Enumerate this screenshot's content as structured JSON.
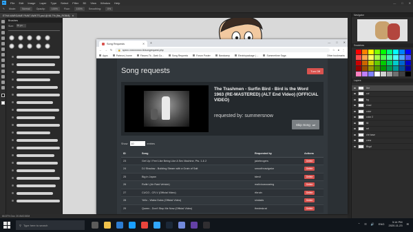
{
  "photoshop": {
    "logo": "Ps",
    "menus": [
      "File",
      "Edit",
      "Image",
      "Layer",
      "Type",
      "Select",
      "Filter",
      "3D",
      "View",
      "Window",
      "Help"
    ],
    "options": {
      "mode_label": "Mode:",
      "mode_value": "Normal",
      "opacity_label": "Opacity:",
      "opacity_value": "100%",
      "flow_label": "Flow:",
      "flow_value": "100%",
      "smoothing_label": "Smoothing:",
      "smoothing_value": "0%"
    },
    "doc_tab": "ETHA WARGAME PAINT AWKTS.psd @ 66.7% (fbs_RGB/8)",
    "brush_panel_title": "Brushes",
    "brush_size_label": "Size:",
    "brush_size_value": "36 px",
    "status": "66.67%   Doc: 20.6M/2.80M",
    "navigator_title": "Navigator",
    "swatches_title": "Swatches",
    "layers_title": "Layers",
    "layers": [
      "line",
      "col",
      "bg",
      "shad",
      "color",
      "color 2",
      "fill",
      "ref",
      "chr base",
      "crew",
      "Bkgd"
    ],
    "swatch_colors": [
      "#ff0000",
      "#ff8000",
      "#ffff00",
      "#80ff00",
      "#00ff00",
      "#00ff80",
      "#00ffff",
      "#0080ff",
      "#0000ff",
      "#ff4d4d",
      "#ffa64d",
      "#ffff66",
      "#a6ff4d",
      "#4dff4d",
      "#4dffa6",
      "#4dffff",
      "#4da6ff",
      "#4d4dff",
      "#cc0000",
      "#cc6600",
      "#cccc00",
      "#66cc00",
      "#00cc00",
      "#00cc66",
      "#00cccc",
      "#0066cc",
      "#0000cc",
      "#990000",
      "#994d00",
      "#999900",
      "#4d9900",
      "#009900",
      "#00994d",
      "#009999",
      "#004d99",
      "#000099",
      "#ff80c0",
      "#c080ff",
      "#8080ff",
      "#ffffff",
      "#d0d0d0",
      "#a0a0a0",
      "#707070",
      "#404040",
      "#000000"
    ]
  },
  "browser": {
    "tab_title": "Song Requests",
    "url": "spxxx.xxxxxxxxxx.tk/songrequest.php",
    "bookmarks": [
      "Apps",
      "Patreon | home",
      "Flavors.Tk - Dark Co...",
      "Song Requests",
      "Forum Poster",
      "Bandcamp",
      "Electricpackage | ...",
      "Summertime Saga"
    ],
    "other_bookmarks": "Other bookmarks"
  },
  "page": {
    "title": "Song requests",
    "turn_off": "Turn Off",
    "now_playing_title": "The Trashmen - Surfin Bird - Bird is the Word 1963 (RE-MASTERED) (ALT End Video) (OFFICIAL VIDEO)",
    "requested_by": "requested by: summersnow",
    "skip_label": "Skip Song",
    "show_label": "Show",
    "show_value": "10",
    "entries_label": "entries",
    "columns": {
      "id": "ID",
      "song": "Song",
      "requested_by": "Requested by",
      "actions": "Actions"
    },
    "delete_label": "Delete",
    "rows": [
      {
        "id": "23",
        "song": "Get Up I Feel Like Being Like A Sex Machine, Pts. 1 & 2",
        "by": "jakebrogers"
      },
      {
        "id": "24",
        "song": "DJ Shadow - Building Steam with a Grain of Salt",
        "by": "smoothnavigator"
      },
      {
        "id": "25",
        "song": "Big in Japan",
        "by": "tdevil"
      },
      {
        "id": "26",
        "song": "Rollin' (Air Raid Vehicle)",
        "by": "malicioussoaring"
      },
      {
        "id": "27",
        "song": "CUCO - CR-V (Official Video)",
        "by": "rtbruin"
      },
      {
        "id": "28",
        "song": "Yello - Waba Duba (Official Video)",
        "by": "sindads"
      },
      {
        "id": "29",
        "song": "Queen - Don't Stop Me Now (Official Video)",
        "by": "thedeskrat"
      }
    ]
  },
  "taskbar": {
    "search_placeholder": "Type here to search",
    "time": "3:14 PM",
    "date": "2020-11-23",
    "lang": "ENG"
  }
}
